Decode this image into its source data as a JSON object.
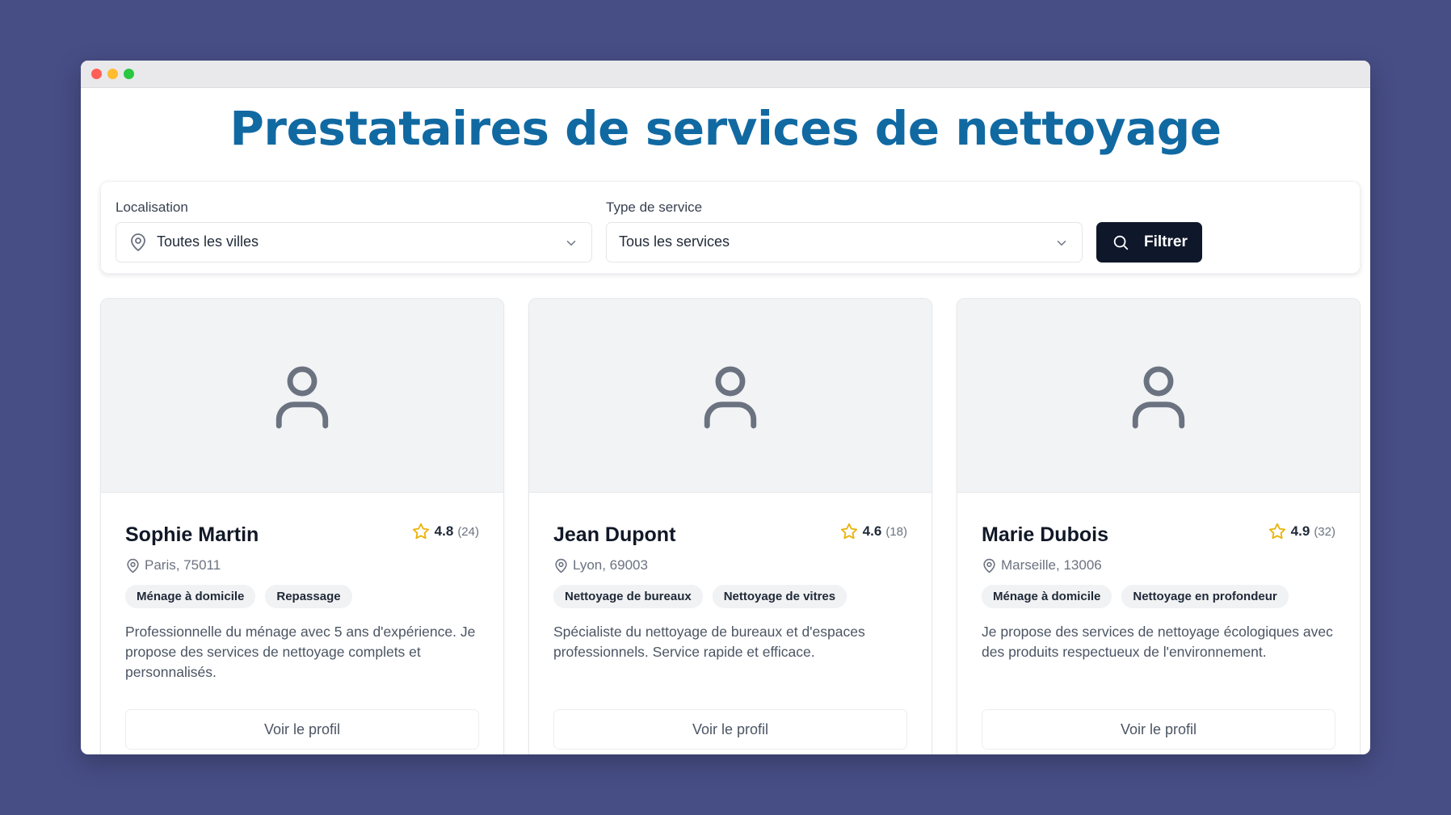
{
  "page": {
    "title": "Prestataires de services de nettoyage"
  },
  "filters": {
    "location": {
      "label": "Localisation",
      "selected": "Toutes les villes",
      "icon": "map-pin-icon"
    },
    "service_type": {
      "label": "Type de service",
      "selected": "Tous les services"
    },
    "filter_button": {
      "label": "Filtrer",
      "icon": "search-icon"
    }
  },
  "providers": [
    {
      "name": "Sophie Martin",
      "rating": "4.8",
      "review_count": "(24)",
      "location": "Paris, 75011",
      "tags": [
        "Ménage à domicile",
        "Repassage"
      ],
      "description": "Professionnelle du ménage avec 5 ans d'expérience. Je propose des services de nettoyage complets et personnalisés.",
      "profile_button": "Voir le profil"
    },
    {
      "name": "Jean Dupont",
      "rating": "4.6",
      "review_count": "(18)",
      "location": "Lyon, 69003",
      "tags": [
        "Nettoyage de bureaux",
        "Nettoyage de vitres"
      ],
      "description": "Spécialiste du nettoyage de bureaux et d'espaces professionnels. Service rapide et efficace.",
      "profile_button": "Voir le profil"
    },
    {
      "name": "Marie Dubois",
      "rating": "4.9",
      "review_count": "(32)",
      "location": "Marseille, 13006",
      "tags": [
        "Ménage à domicile",
        "Nettoyage en profondeur"
      ],
      "description": "Je propose des services de nettoyage écologiques avec des produits respectueux de l'environnement.",
      "profile_button": "Voir le profil"
    }
  ],
  "colors": {
    "background": "#474e86",
    "title": "#1169a2",
    "button_dark": "#0f172a",
    "star": "#eab308"
  }
}
